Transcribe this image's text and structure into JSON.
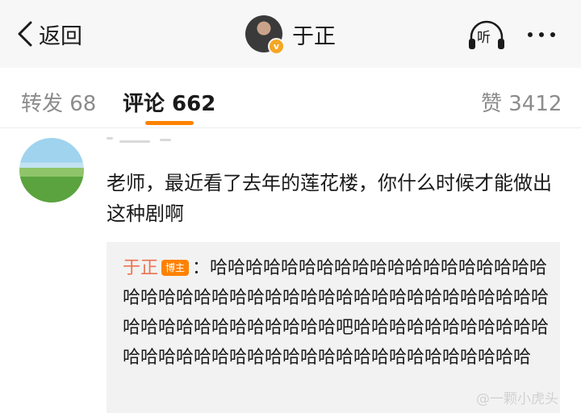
{
  "nav": {
    "back_label": "返回",
    "title": "于正",
    "verified_badge": "v",
    "listen_label": "听",
    "accent_color": "#ff8200"
  },
  "tabs": [
    {
      "label": "转发 68",
      "active": false
    },
    {
      "label": "评论 662",
      "active": true
    },
    {
      "label": "赞 3412",
      "active": false
    }
  ],
  "comment": {
    "text": "老师，最近看了去年的莲花楼，你什么时候才能做出这种剧啊",
    "reply": {
      "author": "于正",
      "badge": "博主",
      "separator": "：",
      "text": "哈哈哈哈哈哈哈哈哈哈哈哈哈哈哈哈哈哈哈哈哈哈哈哈哈哈哈哈哈哈哈哈哈哈哈哈哈哈哈哈哈哈哈哈哈哈哈哈哈哈哈哈哈哈哈吧哈哈哈哈哈哈哈哈哈哈哈哈哈哈哈哈哈哈哈哈哈哈哈哈哈哈哈哈哈哈哈哈哈哈"
    }
  },
  "watermark": "@一颗小虎头"
}
